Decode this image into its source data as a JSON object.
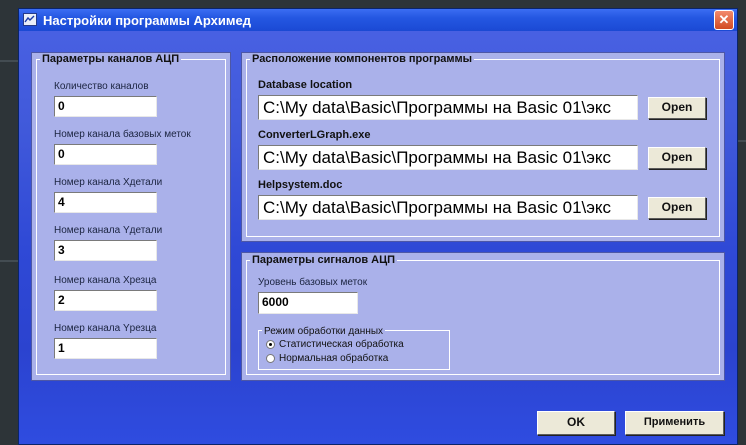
{
  "window": {
    "title": "Настройки программы Архимед",
    "close_glyph": "✕"
  },
  "adc_channels": {
    "title": "Параметры каналов АЦП",
    "fields": [
      {
        "label": "Количество каналов",
        "value": "0"
      },
      {
        "label": "Номер канала базовых меток",
        "value": "0"
      },
      {
        "label": "Номер канала Xдетали",
        "value": "4"
      },
      {
        "label": "Номер канала Yдетали",
        "value": "3"
      },
      {
        "label": "Номер канала Xрезца",
        "value": "2"
      },
      {
        "label": "Номер канала Yрезца",
        "value": "1"
      }
    ]
  },
  "components": {
    "title": "Расположение компонентов программы",
    "items": [
      {
        "label": "Database location",
        "value": "C:\\My data\\Basic\\Программы на Basic 01\\экс",
        "button": "Open"
      },
      {
        "label": "ConverterLGraph.exe",
        "value": "C:\\My data\\Basic\\Программы на Basic 01\\экс",
        "button": "Open"
      },
      {
        "label": "Helpsystem.doc",
        "value": "C:\\My data\\Basic\\Программы на Basic 01\\экс",
        "button": "Open"
      }
    ]
  },
  "adc_signals": {
    "title": "Параметры сигналов АЦП",
    "level_label": "Уровень базовых меток",
    "level_value": "6000",
    "mode": {
      "title": "Режим обработки данных",
      "options": [
        {
          "label": "Статистическая обработка",
          "checked": true
        },
        {
          "label": "Нормальная обработка",
          "checked": false
        }
      ]
    }
  },
  "footer": {
    "ok_label": "OK",
    "apply_label": "Применить"
  },
  "colors": {
    "window_blue": "#3050d8",
    "panel": "#aab1ea",
    "titlebar": "#2457e2",
    "close_red": "#d14a22"
  }
}
